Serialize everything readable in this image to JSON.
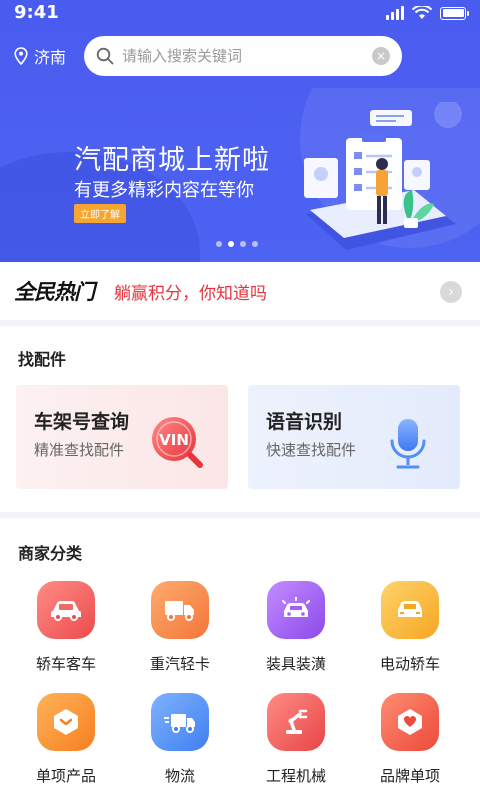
{
  "status": {
    "time": "9:41"
  },
  "location": {
    "city": "济南"
  },
  "search": {
    "placeholder": "请输入搜索关键词",
    "clear": "×"
  },
  "banner": {
    "title": "汽配商城上新啦",
    "subtitle": "有更多精彩内容在等你",
    "cta": "立即了解",
    "slides": 4,
    "active_slide": 1
  },
  "hot": {
    "logo": "全民热门",
    "text": "躺赢积分，你知道吗",
    "arrow": "›"
  },
  "find_parts": {
    "title": "找配件",
    "cards": [
      {
        "title": "车架号查询",
        "subtitle": "精准查找配件",
        "badge": "VIN",
        "icon": "vin-magnifier-icon"
      },
      {
        "title": "语音识别",
        "subtitle": "快速查找配件",
        "icon": "microphone-icon"
      }
    ]
  },
  "categories": {
    "title": "商家分类",
    "items": [
      {
        "label": "轿车客车",
        "icon": "car-icon",
        "color": "#ef5a5a"
      },
      {
        "label": "重汽轻卡",
        "icon": "truck-icon",
        "color": "#f78a46"
      },
      {
        "label": "装具装潢",
        "icon": "car-decor-icon",
        "color": "#a45ef0"
      },
      {
        "label": "电动轿车",
        "icon": "electric-car-icon",
        "color": "#f7b432"
      },
      {
        "label": "单项产品",
        "icon": "box-icon",
        "color": "#f7952f"
      },
      {
        "label": "物流",
        "icon": "delivery-truck-icon",
        "color": "#4f8ff7"
      },
      {
        "label": "工程机械",
        "icon": "robot-arm-icon",
        "color": "#ef5a5a"
      },
      {
        "label": "品牌单项",
        "icon": "heart-badge-icon",
        "color": "#f25a46"
      }
    ]
  }
}
